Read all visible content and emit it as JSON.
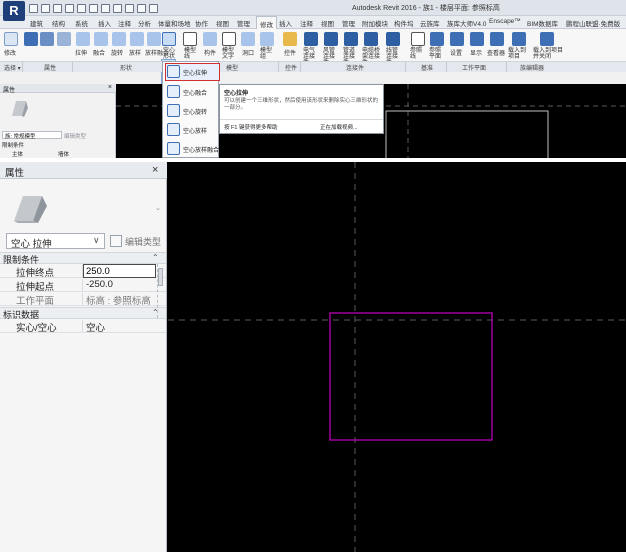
{
  "top": {
    "app_logo": "R",
    "window_title": "Autodesk Revit 2016 -    族1 - 楼层平面: 参照标高",
    "tabs": [
      "建筑",
      "结构",
      "系统",
      "插入",
      "注释",
      "分析",
      "体量和场地",
      "协作",
      "视图",
      "管理",
      "修改",
      "插入",
      "注释",
      "视图",
      "管理",
      "附加模块",
      "构件坞",
      "云族库",
      "族库大师V4.0",
      "Enscape™",
      "BIM数据库",
      "鹏程山联盟·免费版"
    ],
    "ribbon_labels": [
      "修改",
      "拉伸",
      "融合",
      "旋转",
      "放样",
      "放样融合",
      "空心形状",
      "模型线",
      "构件",
      "模型文字",
      "洞口",
      "模型组",
      "控件",
      "电气连接件",
      "风管连接件",
      "管道连接件",
      "电缆桥架连接件",
      "线管连接件",
      "参照线",
      "参照平面",
      "设置",
      "显示",
      "查看器",
      "载入到项目",
      "载入到项目并关闭"
    ],
    "panel_labels": [
      "选择 ▾",
      "属性",
      "形状",
      "模型",
      "控件",
      "连接件",
      "基准",
      "工作平面",
      "族编辑器"
    ],
    "props_title": "属性",
    "props_close": "×",
    "type_name": "族: 常规模型",
    "edit_type": "编辑类型",
    "constraints": "限制条件",
    "host_label": "主体",
    "host_value": "墙体",
    "dropdown_items": [
      "空心拉伸",
      "空心融合",
      "空心旋转",
      "空心放样",
      "空心放样融合"
    ],
    "tooltip": {
      "title": "空心拉伸",
      "desc": "可以创建一个三维形状，然后使用该形状来删除实心三维形状的一部分。",
      "help": "按 F1 键获得更多帮助",
      "video": "正在加载视频..."
    }
  },
  "properties": {
    "title": "属性",
    "close": "×",
    "type_selector": "空心 拉伸",
    "edit_type": "编辑类型",
    "sections": [
      {
        "label": "限制条件",
        "chevron": "⌃",
        "rows": [
          {
            "name": "拉伸终点",
            "value": "250.0"
          },
          {
            "name": "拉伸起点",
            "value": "-250.0"
          },
          {
            "name": "工作平面",
            "value": "标高 : 参照标高"
          }
        ]
      },
      {
        "label": "标识数据",
        "chevron": "⌃",
        "rows": [
          {
            "name": "实心/空心",
            "value": "空心"
          }
        ]
      }
    ]
  },
  "colors": {
    "canvas_bg": "#000000",
    "selection_magenta": "#c400c4",
    "dashed_ref": "#5a5a5a",
    "dropdown_highlight": "#d03030"
  }
}
